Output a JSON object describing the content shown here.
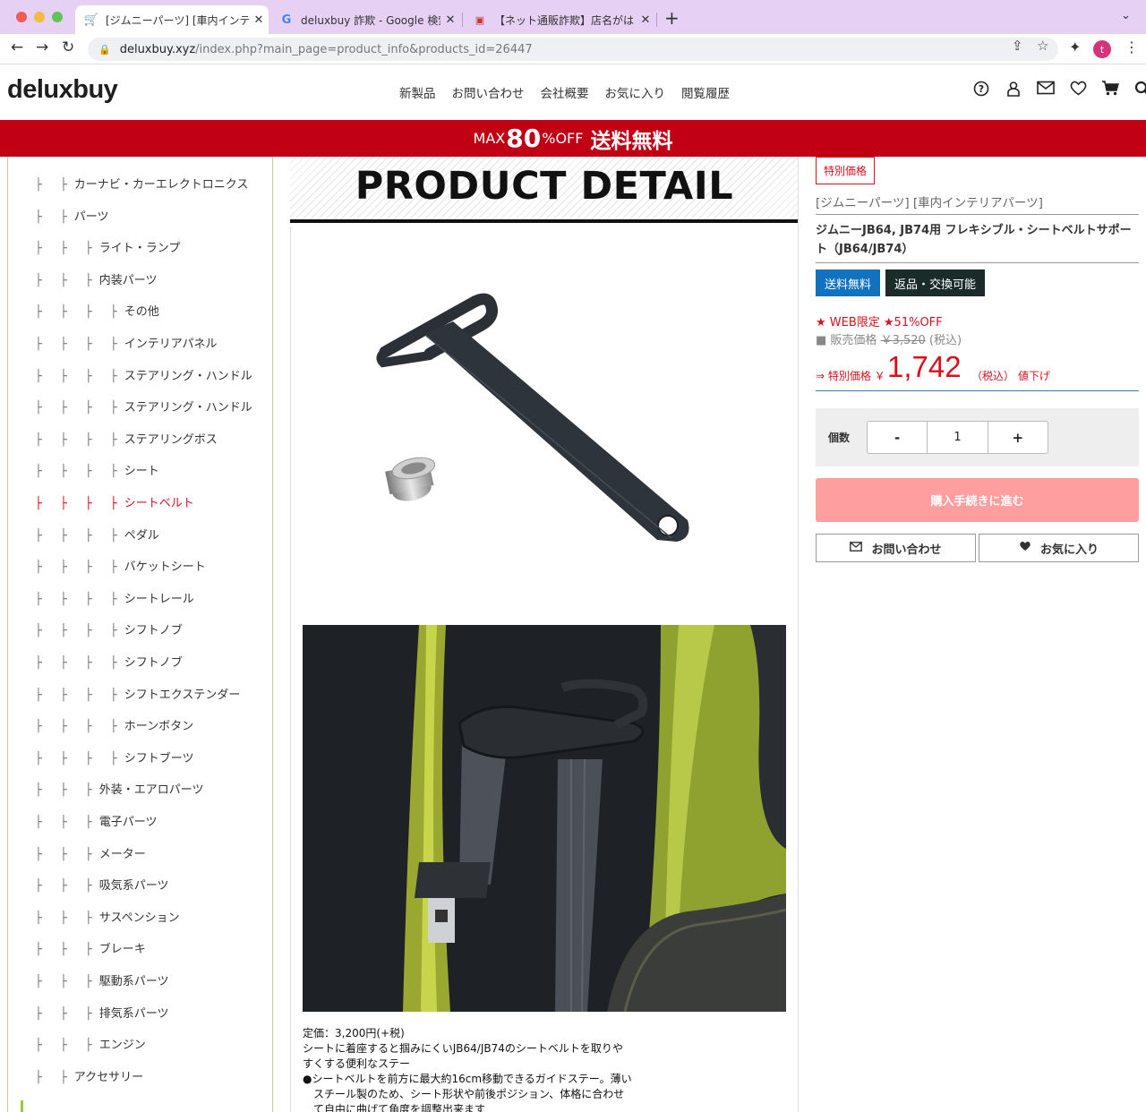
{
  "browser": {
    "tabs": [
      {
        "title": "[ジムニーパーツ] [車内インテリア",
        "icon": "cart-icon",
        "active": true
      },
      {
        "title": "deluxbuy 詐欺 - Google 検索",
        "icon": "google-icon",
        "active": false
      },
      {
        "title": "【ネット通販詐欺】店名がはっきり",
        "icon": "site-icon",
        "active": false
      }
    ],
    "url_domain": "deluxbuy.xyz",
    "url_path": "/index.php?main_page=product_info&products_id=26447",
    "avatar_letter": "t"
  },
  "site": {
    "logo": "deluxbuy",
    "nav": [
      "新製品",
      "お問い合わせ",
      "会社概要",
      "お気に入り",
      "閲覧履歴"
    ],
    "header_icons": [
      "help-icon",
      "account-icon",
      "mail-icon",
      "heart-icon",
      "cart-icon",
      "search-icon"
    ],
    "promo": {
      "a": "MAX",
      "b": "80",
      "c": "%OFF",
      "d": "送料無料"
    },
    "accent_color": "#c20014"
  },
  "sidebar": {
    "items": [
      {
        "tree": "├ ├",
        "label": "カーナビ・カーエレクトロニクス"
      },
      {
        "tree": "├ ├",
        "label": "パーツ"
      },
      {
        "tree": "├ ├ ├",
        "label": "ライト・ランプ"
      },
      {
        "tree": "├ ├ ├",
        "label": "内装パーツ"
      },
      {
        "tree": "├ ├ ├ ├",
        "label": "その他"
      },
      {
        "tree": "├ ├ ├ ├",
        "label": "インテリアパネル"
      },
      {
        "tree": "├ ├ ├ ├",
        "label": "ステアリング・ハンドル"
      },
      {
        "tree": "├ ├ ├ ├",
        "label": "ステアリング・ハンドル"
      },
      {
        "tree": "├ ├ ├ ├",
        "label": "ステアリングボス"
      },
      {
        "tree": "├ ├ ├ ├",
        "label": "シート"
      },
      {
        "tree": "├ ├ ├ ├",
        "label": "シートベルト",
        "current": true
      },
      {
        "tree": "├ ├ ├ ├",
        "label": "ペダル"
      },
      {
        "tree": "├ ├ ├ ├",
        "label": "バケットシート"
      },
      {
        "tree": "├ ├ ├ ├",
        "label": "シートレール"
      },
      {
        "tree": "├ ├ ├ ├",
        "label": "シフトノブ"
      },
      {
        "tree": "├ ├ ├ ├",
        "label": "シフトノブ"
      },
      {
        "tree": "├ ├ ├ ├",
        "label": "シフトエクステンダー"
      },
      {
        "tree": "├ ├ ├ ├",
        "label": "ホーンボタン"
      },
      {
        "tree": "├ ├ ├ ├",
        "label": "シフトブーツ"
      },
      {
        "tree": "├ ├ ├",
        "label": "外装・エアロパーツ"
      },
      {
        "tree": "├ ├ ├",
        "label": "電子パーツ"
      },
      {
        "tree": "├ ├ ├",
        "label": "メーター"
      },
      {
        "tree": "├ ├ ├",
        "label": "吸気系パーツ"
      },
      {
        "tree": "├ ├ ├",
        "label": "サスペンション"
      },
      {
        "tree": "├ ├ ├",
        "label": "ブレーキ"
      },
      {
        "tree": "├ ├ ├",
        "label": "駆動系パーツ"
      },
      {
        "tree": "├ ├ ├",
        "label": "排気系パーツ"
      },
      {
        "tree": "├ ├ ├",
        "label": "エンジン"
      },
      {
        "tree": "├ ├",
        "label": "アクセサリー"
      }
    ]
  },
  "center": {
    "banner": "PRODUCT DETAIL",
    "desc": [
      "定価：3,200円(+税)",
      "シートに着座すると掴みにくいJB64/JB74のシートベルトを取りや",
      "すくする便利なステー",
      "●シートベルトを前方に最大約16cm移動できるガイドステー。薄い",
      "スチール製のため、シート形状や前後ポジション、体格に合わせ",
      "て自由に曲げて角度を調整出来ます"
    ]
  },
  "product": {
    "special_tag": "特別価格",
    "breadcrumb": "[ジムニーパーツ] [車内インテリアパーツ]",
    "name": "ジムニーJB64, JB74用 フレキシブル・シートベルトサポート（JB64/JB74）",
    "badge_free_shipping": "送料無料",
    "badge_returns": "返品・交換可能",
    "web_only": "★ WEB限定 ★51%OFF",
    "orig_label": "■ 販売価格",
    "orig_price": "￥3,520",
    "orig_tax": "(税込)",
    "special_label": "⇒ 特別価格 ￥",
    "price": "1,742",
    "price_tax": "（税込）",
    "price_down": "値下げ",
    "qty_label": "個数",
    "qty_minus": "-",
    "qty_value": "1",
    "qty_plus": "+",
    "buy_button": "購入手続きに進む",
    "contact_button": "お問い合わせ",
    "fav_button": "お気に入り",
    "price_color": "#d8101d",
    "buy_color": "#ff9e9e"
  }
}
